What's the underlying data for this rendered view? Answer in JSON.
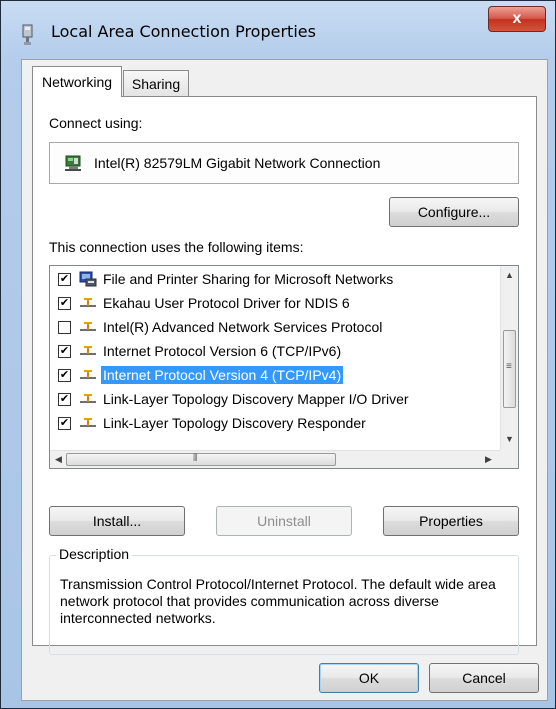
{
  "window": {
    "title": "Local Area Connection Properties",
    "title_icon": "network-adapter-icon",
    "close_label": "x"
  },
  "tabs": [
    {
      "label": "Networking",
      "active": true
    },
    {
      "label": "Sharing",
      "active": false
    }
  ],
  "connect_using": {
    "label": "Connect using:",
    "adapter_icon": "network-card-icon",
    "adapter_name": "Intel(R) 82579LM Gigabit Network Connection",
    "configure_label": "Configure..."
  },
  "items_section": {
    "label": "This connection uses the following items:",
    "items": [
      {
        "label": "File and Printer Sharing for Microsoft Networks",
        "checked": true,
        "icon": "file-printer-sharing-icon",
        "selected": false
      },
      {
        "label": "Ekahau User Protocol Driver for NDIS 6",
        "checked": true,
        "icon": "protocol-icon",
        "selected": false
      },
      {
        "label": "Intel(R) Advanced Network Services Protocol",
        "checked": false,
        "icon": "protocol-icon",
        "selected": false
      },
      {
        "label": "Internet Protocol Version 6 (TCP/IPv6)",
        "checked": true,
        "icon": "protocol-icon",
        "selected": false
      },
      {
        "label": "Internet Protocol Version 4 (TCP/IPv4)",
        "checked": true,
        "icon": "protocol-icon",
        "selected": true
      },
      {
        "label": "Link-Layer Topology Discovery Mapper I/O Driver",
        "checked": true,
        "icon": "protocol-icon",
        "selected": false
      },
      {
        "label": "Link-Layer Topology Discovery Responder",
        "checked": true,
        "icon": "protocol-icon",
        "selected": false
      }
    ]
  },
  "buttons": {
    "install": "Install...",
    "uninstall": "Uninstall",
    "properties": "Properties",
    "ok": "OK",
    "cancel": "Cancel"
  },
  "description": {
    "legend": "Description",
    "text": "Transmission Control Protocol/Internet Protocol. The default wide area network protocol that provides communication across diverse interconnected networks."
  },
  "colors": {
    "selection": "#3399ff",
    "frame": "#b3cdeb",
    "close_button": "#c2321f"
  }
}
